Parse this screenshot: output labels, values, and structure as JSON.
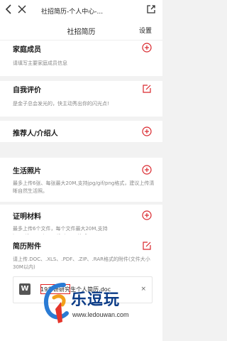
{
  "topbar": {
    "title": "社招简历-个人中心-...",
    "back_icon": "chevron-left-icon",
    "close_icon": "close-icon",
    "share_icon": "share-icon"
  },
  "navbar": {
    "title": "社招简历",
    "settings_label": "设置"
  },
  "sections": [
    {
      "title": "家庭成员",
      "desc": "请填写主要家庭成员信息",
      "action_icon": "add-circle-icon"
    },
    {
      "title": "自我评价",
      "desc": "是金子总会发光的，快主动秀出你的闪光点!",
      "action_icon": "edit-icon"
    },
    {
      "title": "推荐人/介绍人",
      "desc": "",
      "action_icon": "add-circle-icon"
    },
    {
      "title": "生活照片",
      "desc": "最多上传6张、每张最大20M,支持jpg/gif/png格式，建议上传清晰自然生活照。",
      "action_icon": "add-circle-icon"
    },
    {
      "title": "证明材料",
      "desc": "最多上传6个文件，每个文件最大20M,支持jpg/gif/png/doc/pdf/zip/rar格式。",
      "action_icon": "add-circle-icon"
    },
    {
      "title": "简历附件",
      "desc": "请上传.DOC、.XLS、.PDF、.ZIP、.RAR格式的附件(文件大小30M以内)",
      "action_icon": "edit-icon"
    }
  ],
  "attachment": {
    "icon_letter": "W",
    "file_name": "19考研研究生个人简历.doc",
    "remove_label": "×"
  },
  "watermark": {
    "brand": "乐逗玩",
    "url": "www.ledouwan.com"
  },
  "colors": {
    "accent": "#d9262c",
    "brand_blue": "#0a3b87"
  }
}
